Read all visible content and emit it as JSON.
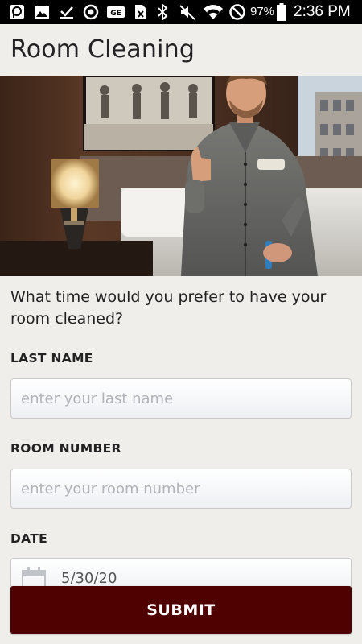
{
  "status_bar": {
    "battery": "97%",
    "time": "2:36 PM",
    "icons": [
      "app-p-icon",
      "image-icon",
      "download-done-icon",
      "sync-icon",
      "ge-icon",
      "no-sim-icon",
      "bluetooth-icon",
      "mute-icon",
      "wifi-icon",
      "do-not-disturb-icon",
      "battery-icon"
    ]
  },
  "header": {
    "title": "Room Cleaning"
  },
  "hero": {
    "description_icon": "hotel-housekeeper-photo"
  },
  "form": {
    "prompt": "What time would you prefer to have your room cleaned?",
    "last_name": {
      "label": "LAST NAME",
      "placeholder": "enter your last name"
    },
    "room_number": {
      "label": "ROOM NUMBER",
      "placeholder": "enter your room number"
    },
    "date": {
      "label": "DATE",
      "value": "5/30/20",
      "icon": "calendar-icon"
    }
  },
  "submit": {
    "label": "SUBMIT",
    "color": "#4f0000"
  },
  "colors": {
    "background": "#efeeea",
    "accent": "#4f0000",
    "status_bar": "#000000"
  }
}
